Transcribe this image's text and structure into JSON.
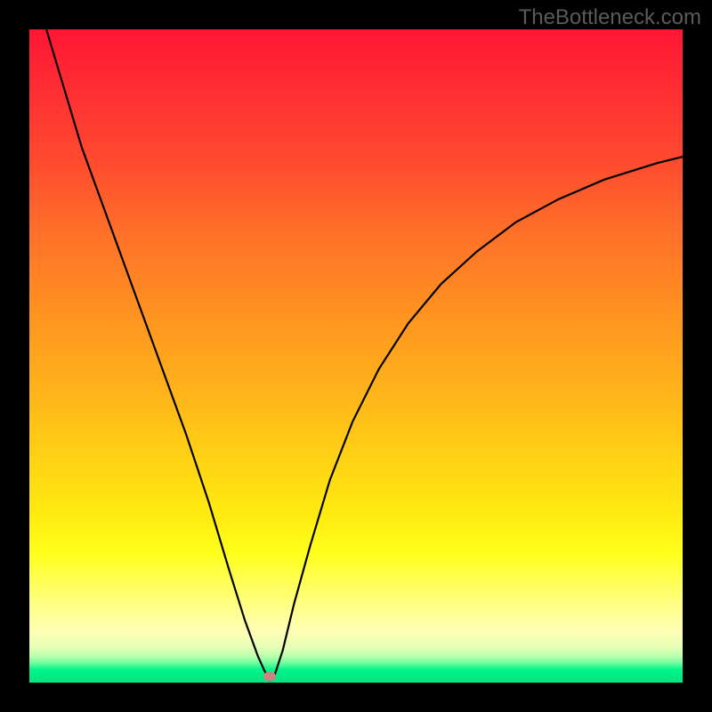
{
  "watermark": "TheBottleneck.com",
  "chart_data": {
    "type": "line",
    "title": "",
    "xlabel": "",
    "ylabel": "",
    "xlim": [
      0,
      1
    ],
    "ylim": [
      0,
      1
    ],
    "series": [
      {
        "name": "bottleneck-curve",
        "x": [
          0.02,
          0.05,
          0.08,
          0.12,
          0.16,
          0.2,
          0.24,
          0.275,
          0.305,
          0.33,
          0.35,
          0.36,
          0.368,
          0.375,
          0.388,
          0.405,
          0.43,
          0.46,
          0.495,
          0.535,
          0.58,
          0.63,
          0.685,
          0.745,
          0.81,
          0.88,
          0.96,
          1.0
        ],
        "values": [
          1.02,
          0.92,
          0.82,
          0.71,
          0.6,
          0.49,
          0.38,
          0.275,
          0.175,
          0.095,
          0.04,
          0.018,
          0.004,
          0.01,
          0.05,
          0.12,
          0.21,
          0.31,
          0.4,
          0.48,
          0.55,
          0.61,
          0.66,
          0.705,
          0.74,
          0.77,
          0.795,
          0.805
        ]
      }
    ],
    "marker": {
      "x": 0.368,
      "y": 0.004
    }
  },
  "colors": {
    "curve": "#000000",
    "marker": "#c98484",
    "top": "#ff1633",
    "bottom": "#00e57e"
  }
}
